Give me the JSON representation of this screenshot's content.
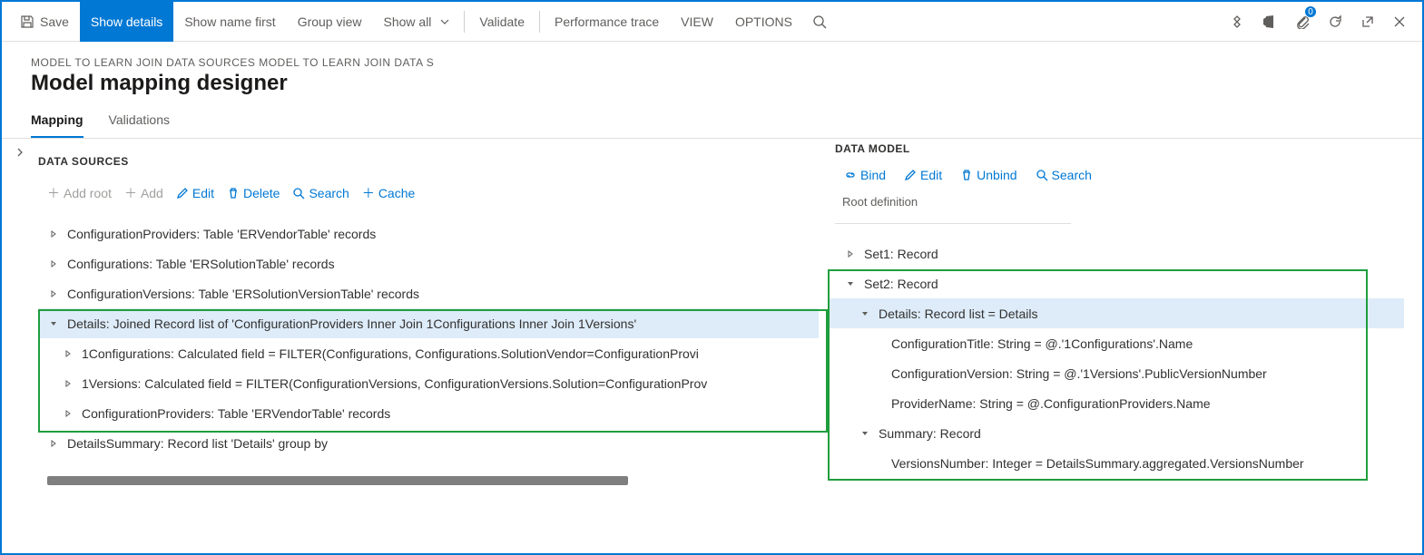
{
  "toolbar": {
    "save": "Save",
    "show_details": "Show details",
    "show_name_first": "Show name first",
    "group_view": "Group view",
    "show_all": "Show all",
    "validate": "Validate",
    "performance_trace": "Performance trace",
    "view": "VIEW",
    "options": "OPTIONS",
    "badge_count": "0"
  },
  "header": {
    "breadcrumb": "MODEL TO LEARN JOIN DATA SOURCES MODEL TO LEARN JOIN DATA S",
    "title": "Model mapping designer"
  },
  "tabs": {
    "mapping": "Mapping",
    "validations": "Validations"
  },
  "left": {
    "title": "DATA SOURCES",
    "buttons": {
      "add_root": "Add root",
      "add": "Add",
      "edit": "Edit",
      "delete": "Delete",
      "search": "Search",
      "cache": "Cache"
    },
    "rows": [
      "ConfigurationProviders: Table 'ERVendorTable' records",
      "Configurations: Table 'ERSolutionTable' records",
      "ConfigurationVersions: Table 'ERSolutionVersionTable' records",
      "Details: Joined Record list of 'ConfigurationProviders Inner Join 1Configurations Inner Join 1Versions'",
      "1Configurations: Calculated field = FILTER(Configurations, Configurations.SolutionVendor=ConfigurationProvi",
      "1Versions: Calculated field = FILTER(ConfigurationVersions, ConfigurationVersions.Solution=ConfigurationProv",
      "ConfigurationProviders: Table 'ERVendorTable' records",
      "DetailsSummary: Record list 'Details' group by"
    ]
  },
  "right": {
    "title": "DATA MODEL",
    "buttons": {
      "bind": "Bind",
      "edit": "Edit",
      "unbind": "Unbind",
      "search": "Search"
    },
    "root_def": "Root definition",
    "rows": [
      "Set1: Record",
      "Set2: Record",
      "Details: Record list = Details",
      "ConfigurationTitle: String = @.'1Configurations'.Name",
      "ConfigurationVersion: String = @.'1Versions'.PublicVersionNumber",
      "ProviderName: String = @.ConfigurationProviders.Name",
      "Summary: Record",
      "VersionsNumber: Integer = DetailsSummary.aggregated.VersionsNumber"
    ]
  }
}
